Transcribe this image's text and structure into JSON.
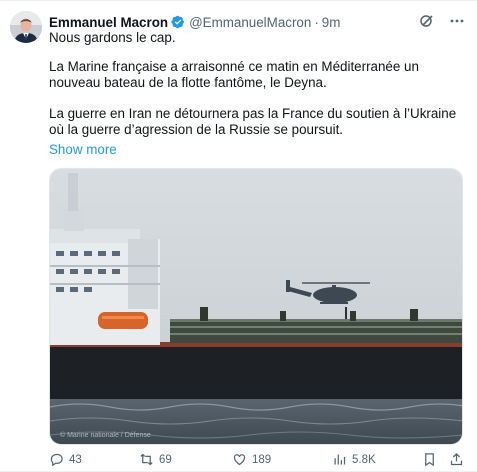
{
  "post": {
    "author_name": "Emmanuel Macron",
    "handle": "@EmmanuelMacron",
    "separator": "·",
    "time": "9m",
    "paragraphs": [
      "Nous gardons le cap.",
      "La Marine française a arraisonné ce matin en Méditerranée un nouveau bateau de la flotte fantôme, le Deyna.",
      "La guerre en Iran ne détournera pas la France du soutien à l’Ukraine où la guerre d’agression de la Russie se poursuit."
    ],
    "show_more": "Show more",
    "image_watermark": "© Marine nationale / Défense",
    "image_alt": "Photo of a French navy helicopter hovering above the deck of a large tanker at sea"
  },
  "actions": {
    "replies": "43",
    "reposts": "69",
    "likes": "189",
    "views": "5.8K"
  },
  "icons": [
    "verified-badge-icon",
    "grok-icon",
    "more-icon",
    "reply-icon",
    "repost-icon",
    "like-icon",
    "views-icon",
    "bookmark-icon",
    "share-icon"
  ],
  "colors": {
    "text": "#0f1419",
    "secondary": "#536471",
    "link": "#1d9bf0",
    "verified": "#1d9bf0"
  }
}
